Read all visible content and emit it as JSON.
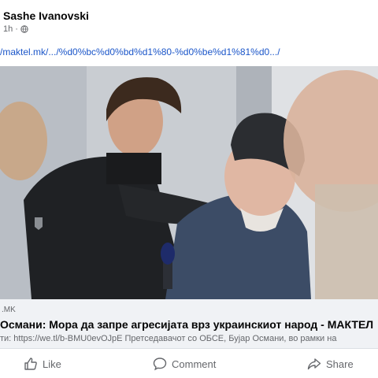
{
  "post": {
    "author": "Sashe Ivanovski",
    "time": "1h",
    "separator": "·",
    "link_text": "/maktel.mk/.../%d0%bc%d0%bd%d1%80-%d0%be%d1%81%d0.../"
  },
  "preview": {
    "domain": ".MK",
    "title": "Османи: Мора да запре агресијата врз украинскиот народ - МАКТЕЛ",
    "description": "ти: https://we.tl/b-BMU0evOJpE Претседавачот со ОБСЕ, Бујар Османи, во рамки на"
  },
  "actions": {
    "like": "Like",
    "comment": "Comment",
    "share": "Share"
  },
  "icons": {
    "privacy": "globe-icon",
    "like": "thumbs-up-icon",
    "comment": "comment-icon",
    "share": "share-icon"
  },
  "colors": {
    "link": "#1b56c9",
    "secondary_text": "#65676b",
    "primary_text": "#050505",
    "preview_bg": "#f0f2f5"
  }
}
